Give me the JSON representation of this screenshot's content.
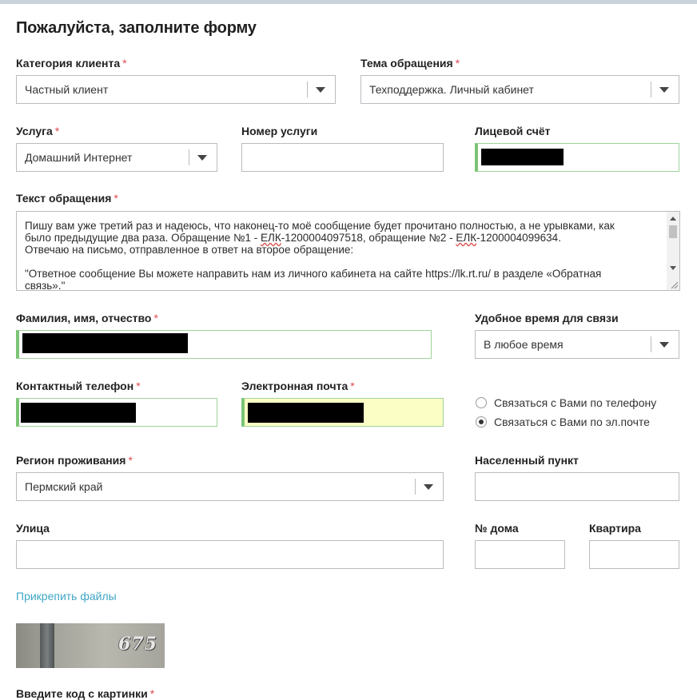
{
  "form": {
    "title": "Пожалуйста, заполните форму",
    "required_mark": "*"
  },
  "client_category": {
    "label": "Категория клиента",
    "value": "Частный клиент"
  },
  "topic": {
    "label": "Тема обращения",
    "value": "Техподдержка. Личный кабинет"
  },
  "service": {
    "label": "Услуга",
    "value": "Домашний Интернет"
  },
  "service_number": {
    "label": "Номер услуги",
    "value": ""
  },
  "account": {
    "label": "Лицевой счёт"
  },
  "message": {
    "label": "Текст обращения",
    "line1": "Пишу вам уже третий раз и надеюсь, что наконец-то моё сообщение будет прочитано полностью, а не урывками, как",
    "line2_pre": "было предыдущие два раза. Обращение №1 - ",
    "elk1": "ЕЛК",
    "line2_mid": "-1200004097518, обращение №2 - ",
    "elk2": "ЕЛК",
    "line2_post": "-1200004099634.",
    "line3": "Отвечаю на письмо, отправленное в ответ на второе обращение:",
    "line5": "\"Ответное сообщение Вы можете направить нам из личного кабинета на сайте https://lk.rt.ru/ в разделе «Обратная",
    "line6": "связь».\""
  },
  "full_name": {
    "label": "Фамилия, имя, отчество"
  },
  "contact_time": {
    "label": "Удобное время для связи",
    "value": "В любое время"
  },
  "phone": {
    "label": "Контактный телефон"
  },
  "email": {
    "label": "Электронная почта"
  },
  "contact_method": {
    "options": [
      {
        "label": "Связаться с Вами по телефону",
        "checked": false
      },
      {
        "label": "Связаться с Вами по эл.почте",
        "checked": true
      }
    ]
  },
  "region": {
    "label": "Регион проживания",
    "value": "Пермский край"
  },
  "city": {
    "label": "Населенный пункт",
    "value": ""
  },
  "street": {
    "label": "Улица",
    "value": ""
  },
  "house": {
    "label": "№ дома",
    "value": ""
  },
  "apartment": {
    "label": "Квартира",
    "value": ""
  },
  "attach_link": "Прикрепить файлы",
  "captcha": {
    "text": "675",
    "label": "Введите код с картинки"
  },
  "colors": {
    "required": "#e0494f",
    "valid_border": "#7cc475",
    "autofill": "#fbfec5",
    "link": "#3fa6c5"
  },
  "icons": {
    "dropdown": "chevron-down-icon",
    "resize": "resize-grip-icon"
  }
}
